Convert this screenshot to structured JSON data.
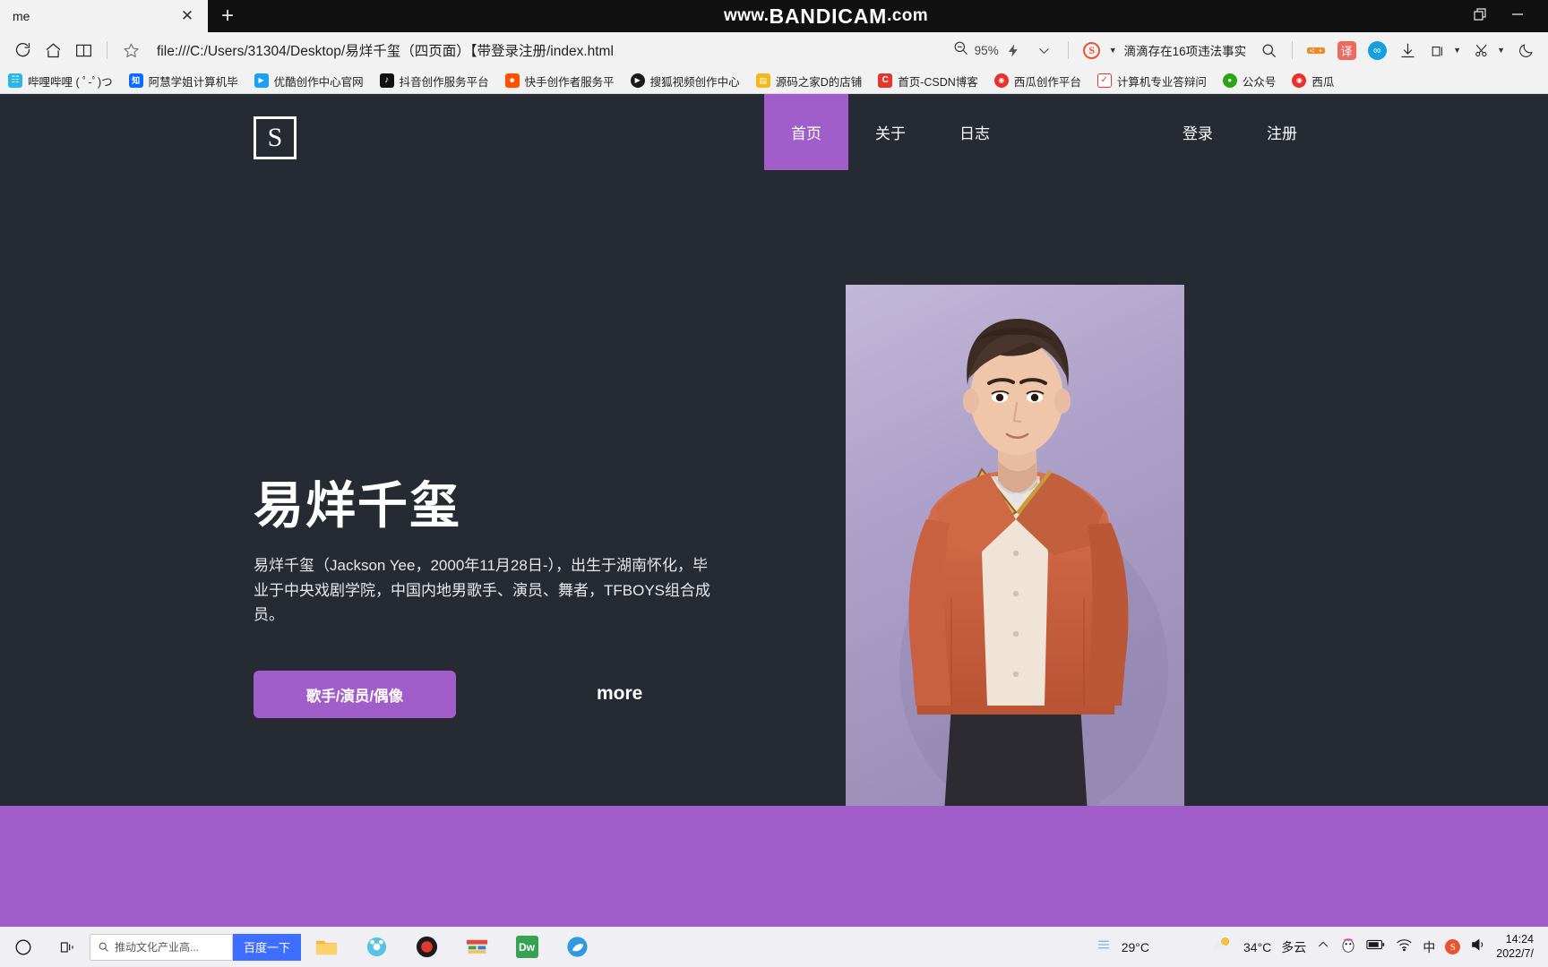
{
  "browser": {
    "tab": {
      "title": "me",
      "close_icon": "close-icon",
      "new_tab_icon": "plus-icon"
    },
    "watermark": {
      "prefix": "www.",
      "brand": "BANDICAM",
      "suffix": ".com"
    },
    "window_controls": {
      "restore_icon": "restore-window-icon",
      "minimize_icon": "minimize-icon"
    },
    "toolbar": {
      "reload_icon": "reload-icon",
      "home_icon": "home-icon",
      "reading_list_icon": "book-icon",
      "favorite_icon": "star-icon",
      "url": "file:///C:/Users/31304/Desktop/易烊千玺（四页面）【带登录注册/index.html",
      "zoom_out_icon": "zoom-out-icon",
      "zoom_level": "95%",
      "lightning_icon": "lightning-icon",
      "chevron_icon": "chevron-down-icon",
      "sogou_icon": "sogou-icon",
      "news_headline": "滴滴存在16项违法事实",
      "search_icon": "search-icon",
      "game_icon": "gamepad-icon",
      "translate_icon": "translate-icon",
      "wechat_icon": "wechat-icon",
      "download_icon": "download-icon",
      "collections_icon": "collections-icon",
      "scissors_icon": "scissors-icon",
      "moon_icon": "moon-icon"
    },
    "bookmarks": [
      {
        "label": "哔哩哔哩 ( ﾟ-ﾟ)つ",
        "icon": "bilibili-icon",
        "color": "#29b7ea",
        "glyph": "b"
      },
      {
        "label": "阿慧学姐计算机毕",
        "icon": "zhihu-icon",
        "color": "#0b6cff",
        "glyph": "知"
      },
      {
        "label": "优酷创作中心官网",
        "icon": "youku-icon",
        "color": "#1ba0f4",
        "glyph": "▶"
      },
      {
        "label": "抖音创作服务平台",
        "icon": "douyin-icon",
        "color": "#111111",
        "glyph": "♪"
      },
      {
        "label": "快手创作者服务平",
        "icon": "kuaishou-icon",
        "color": "#ff5000",
        "glyph": "快"
      },
      {
        "label": "搜狐视频创作中心",
        "icon": "sohu-icon",
        "color": "#1b1b1b",
        "glyph": "▶"
      },
      {
        "label": "源码之家D的店铺",
        "icon": "shop-icon",
        "color": "#f5b71c",
        "glyph": "▤"
      },
      {
        "label": "首页-CSDN博客",
        "icon": "csdn-icon",
        "color": "#e3352a",
        "glyph": "C"
      },
      {
        "label": "西瓜创作平台",
        "icon": "xigua-icon",
        "color": "#e8312a",
        "glyph": "◉"
      },
      {
        "label": "计算机专业答辩问",
        "icon": "doc-icon",
        "color": "#e23b2c",
        "glyph": "✓"
      },
      {
        "label": "公众号",
        "icon": "wechat-public-icon",
        "color": "#2aa515",
        "glyph": "●"
      },
      {
        "label": "西瓜",
        "icon": "xigua2-icon",
        "color": "#e8312a",
        "glyph": "◉"
      }
    ]
  },
  "site": {
    "logo_letter": "S",
    "nav": [
      {
        "label": "首页",
        "active": true
      },
      {
        "label": "关于",
        "active": false
      },
      {
        "label": "日志",
        "active": false
      }
    ],
    "nav_right": [
      {
        "label": "登录"
      },
      {
        "label": "注册"
      }
    ],
    "hero": {
      "title": "易烊千玺",
      "description": "易烊千玺（Jackson Yee，2000年11月28日-），出生于湖南怀化，毕业于中央戏剧学院，中国内地男歌手、演员、舞者，TFBOYS组合成员。",
      "cta_label": "歌手/演员/偶像",
      "more_label": "more",
      "photo_alt": "易烊千玺-portrait"
    },
    "accent_color": "#a15dca",
    "background_color": "#262a33"
  },
  "taskbar": {
    "start_icon": "windows-start-icon",
    "task_view_icon": "task-view-icon",
    "search_placeholder": "推动文化产业高...",
    "search_button_label": "百度一下",
    "apps": [
      {
        "name": "file-explorer-icon"
      },
      {
        "name": "bandicam-icon"
      },
      {
        "name": "recorder-icon"
      },
      {
        "name": "store-icon"
      },
      {
        "name": "dreamweaver-icon",
        "glyph": "Dw"
      },
      {
        "name": "browser-icon"
      }
    ],
    "news_temp": "29°C",
    "weather_temp": "34°C",
    "weather_desc": "多云",
    "tray_icons": [
      "chevron-up-icon",
      "qq-icon",
      "battery-icon",
      "wifi-icon",
      "ime-icon",
      "sogou-icon",
      "volume-icon"
    ],
    "clock_time": "14:24",
    "clock_date": "2022/7/"
  }
}
